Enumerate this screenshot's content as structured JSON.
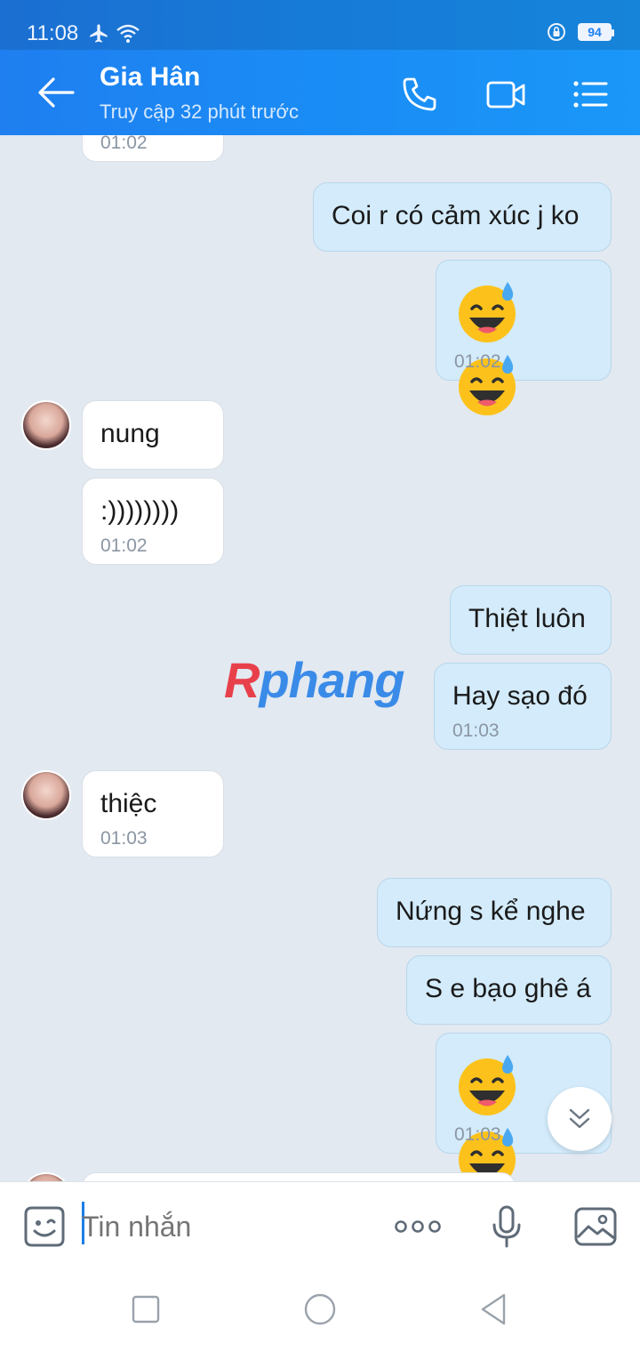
{
  "status_bar": {
    "time": "11:08",
    "battery": "94"
  },
  "header": {
    "contact_name": "Gia Hân",
    "last_seen": "Truy cập 32 phút trước"
  },
  "messages": [
    {
      "time": "01:02"
    },
    {
      "text": "Coi r có cảm xúc j ko"
    },
    {
      "emojis": "😅😅",
      "time": "01:02"
    },
    {
      "text": "nung"
    },
    {
      "text": ":))))))))",
      "time": "01:02"
    },
    {
      "text": "Thiệt luôn"
    },
    {
      "text": "Hay sạo đó",
      "time": "01:03"
    },
    {
      "text": "thiệc",
      "time": "01:03"
    },
    {
      "text": "Nứng s kể nghe"
    },
    {
      "text": "S e bạo ghê á"
    },
    {
      "emojis": "😅😅",
      "time": "01:03"
    }
  ],
  "watermark": {
    "first": "R",
    "rest": "phang"
  },
  "input": {
    "placeholder": "Tin nhắn"
  },
  "icons": {
    "back": "arrow-left-icon",
    "call": "phone-icon",
    "video": "video-camera-icon",
    "menu": "list-menu-icon",
    "sticker": "sticker-smile-icon",
    "more": "more-dots-icon",
    "mic": "microphone-icon",
    "image": "image-icon",
    "scroll": "double-chevron-down-icon"
  },
  "colors": {
    "header": "#1f7ff0",
    "outgoing_bubble": "#d3ebfb",
    "incoming_bubble": "#ffffff",
    "chat_bg": "#e2e9f1"
  }
}
